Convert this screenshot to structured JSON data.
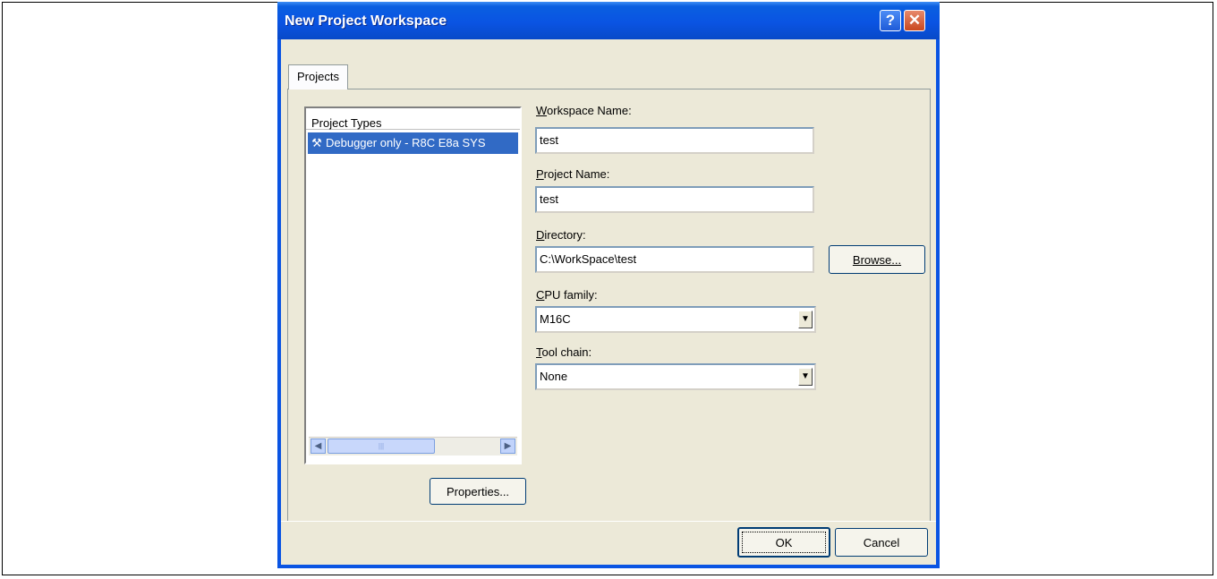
{
  "window": {
    "title": "New Project Workspace",
    "help_glyph": "?",
    "close_glyph": "✕"
  },
  "tabs": [
    {
      "label": "Projects"
    }
  ],
  "project_types": {
    "header": "Project Types",
    "items": [
      {
        "label": "Debugger only - R8C E8a SYS",
        "icon": "hammer-icon",
        "selected": true
      }
    ]
  },
  "scrollbar": {
    "left_glyph": "◀",
    "right_glyph": "▶",
    "thumb_grip": "|||"
  },
  "buttons": {
    "properties": "Properties...",
    "browse": "Browse...",
    "ok": "OK",
    "cancel": "Cancel"
  },
  "fields": {
    "workspace_name": {
      "mnemonic": "W",
      "label_rest": "orkspace Name:",
      "value": "test"
    },
    "project_name": {
      "mnemonic": "P",
      "label_rest": "roject Name:",
      "value": "test"
    },
    "directory": {
      "mnemonic": "D",
      "label_rest": "irectory:",
      "value": "C:\\WorkSpace\\test"
    },
    "cpu_family": {
      "mnemonic": "C",
      "label_rest": "PU family:",
      "value": "M16C"
    },
    "tool_chain": {
      "mnemonic": "T",
      "label_rest": "ool chain:",
      "value": "None"
    }
  },
  "colors": {
    "titlebar": "#0a54e3",
    "dialog_bg": "#ece9d8",
    "selection": "#316ac5"
  }
}
